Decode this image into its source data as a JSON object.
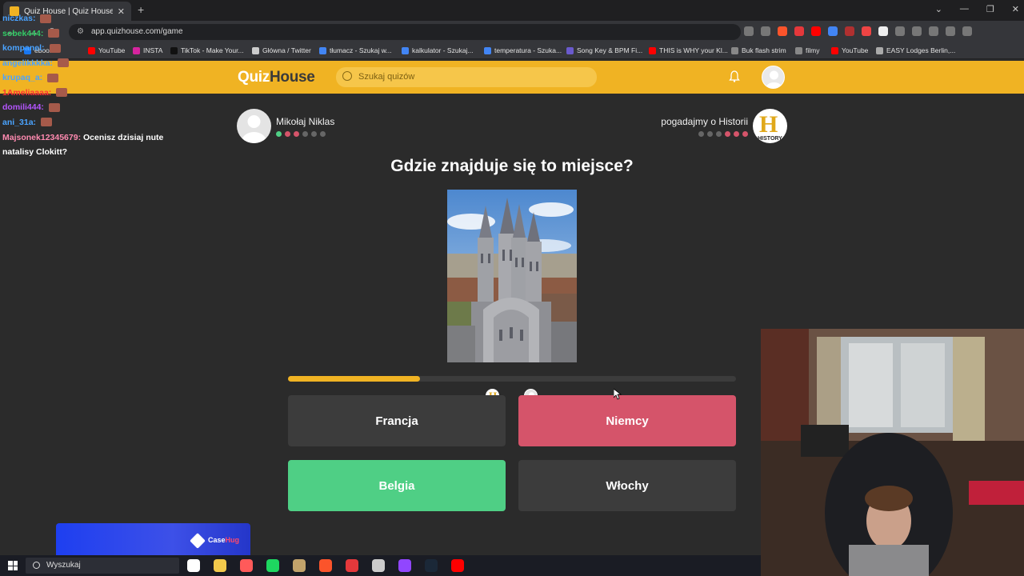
{
  "browser": {
    "tab_title": "Quiz House | Quiz House",
    "url": "app.quizhouse.com/game",
    "bookmarks": [
      {
        "label": "ebook",
        "color": "#1877f2"
      },
      {
        "label": "YouTube",
        "color": "#ff0000"
      },
      {
        "label": "INSTA",
        "color": "#d6249f"
      },
      {
        "label": "TikTok - Make Your...",
        "color": "#111111"
      },
      {
        "label": "Główna / Twitter",
        "color": "#cccccc"
      },
      {
        "label": "tłumacz - Szukaj w...",
        "color": "#4285f4"
      },
      {
        "label": "kalkulator - Szukaj...",
        "color": "#4285f4"
      },
      {
        "label": "temperatura - Szuka...",
        "color": "#4285f4"
      },
      {
        "label": "Song Key & BPM Fi...",
        "color": "#6a5acd"
      },
      {
        "label": "THIS is WHY your Kl...",
        "color": "#ff0000"
      },
      {
        "label": "Buk flash strim",
        "color": "#888888"
      },
      {
        "label": "filmy",
        "color": "#888888"
      },
      {
        "label": "YouTube",
        "color": "#ff0000"
      },
      {
        "label": "EASY Lodges Berlin,...",
        "color": "#aaaaaa"
      }
    ]
  },
  "header": {
    "logo_part1": "Quiz",
    "logo_part2": "House",
    "search_placeholder": "Szukaj quizów",
    "brand_color": "#f0b323"
  },
  "game": {
    "player1_name": "Mikołaj Niklas",
    "player1_dots": [
      "#4fcf85",
      "#d5546a",
      "#d5546a",
      "#666666",
      "#666666",
      "#666666"
    ],
    "player2_name": "pogadajmy o Historii",
    "player2_dots": [
      "#666666",
      "#666666",
      "#666666",
      "#d5546a",
      "#d5546a",
      "#d5546a"
    ],
    "player2_logo_text": "HISTORY",
    "question": "Gdzie znajduje się to miejsce?",
    "progress": 0.295,
    "answers": [
      {
        "label": "Francja",
        "state": "neutral"
      },
      {
        "label": "Niemcy",
        "state": "wrong"
      },
      {
        "label": "Belgia",
        "state": "correct"
      },
      {
        "label": "Włochy",
        "state": "neutral"
      }
    ]
  },
  "chat": {
    "users": [
      {
        "name": "niczkas",
        "color": "#4aa3ff"
      },
      {
        "name": "sobek444",
        "color": "#33cc66"
      },
      {
        "name": "kompanel",
        "color": "#4aa3ff"
      },
      {
        "name": "angelikkkka",
        "color": "#4aa3ff"
      },
      {
        "name": "krupaq_a",
        "color": "#4aa3ff"
      },
      {
        "name": "1Ameliaaaa",
        "color": "#ff3333"
      },
      {
        "name": "domili444",
        "color": "#b455ff"
      },
      {
        "name": "ani_31a",
        "color": "#4aa3ff"
      }
    ],
    "message_user": "Majsonek12345679:",
    "message_text": "Ocenisz dzisiaj nute natalisy Clokitt?"
  },
  "sponsor": {
    "label_part1": "Case",
    "label_part2": "Hug"
  },
  "taskbar": {
    "search_label": "Wyszukaj",
    "apps": [
      "#ffffff",
      "#f2c94c",
      "#ff5a5a",
      "#1ed760",
      "#c2a36b",
      "#fb542b",
      "#e5383b",
      "#cccccc",
      "#9146ff",
      "#1b2838",
      "#ff0000"
    ]
  }
}
